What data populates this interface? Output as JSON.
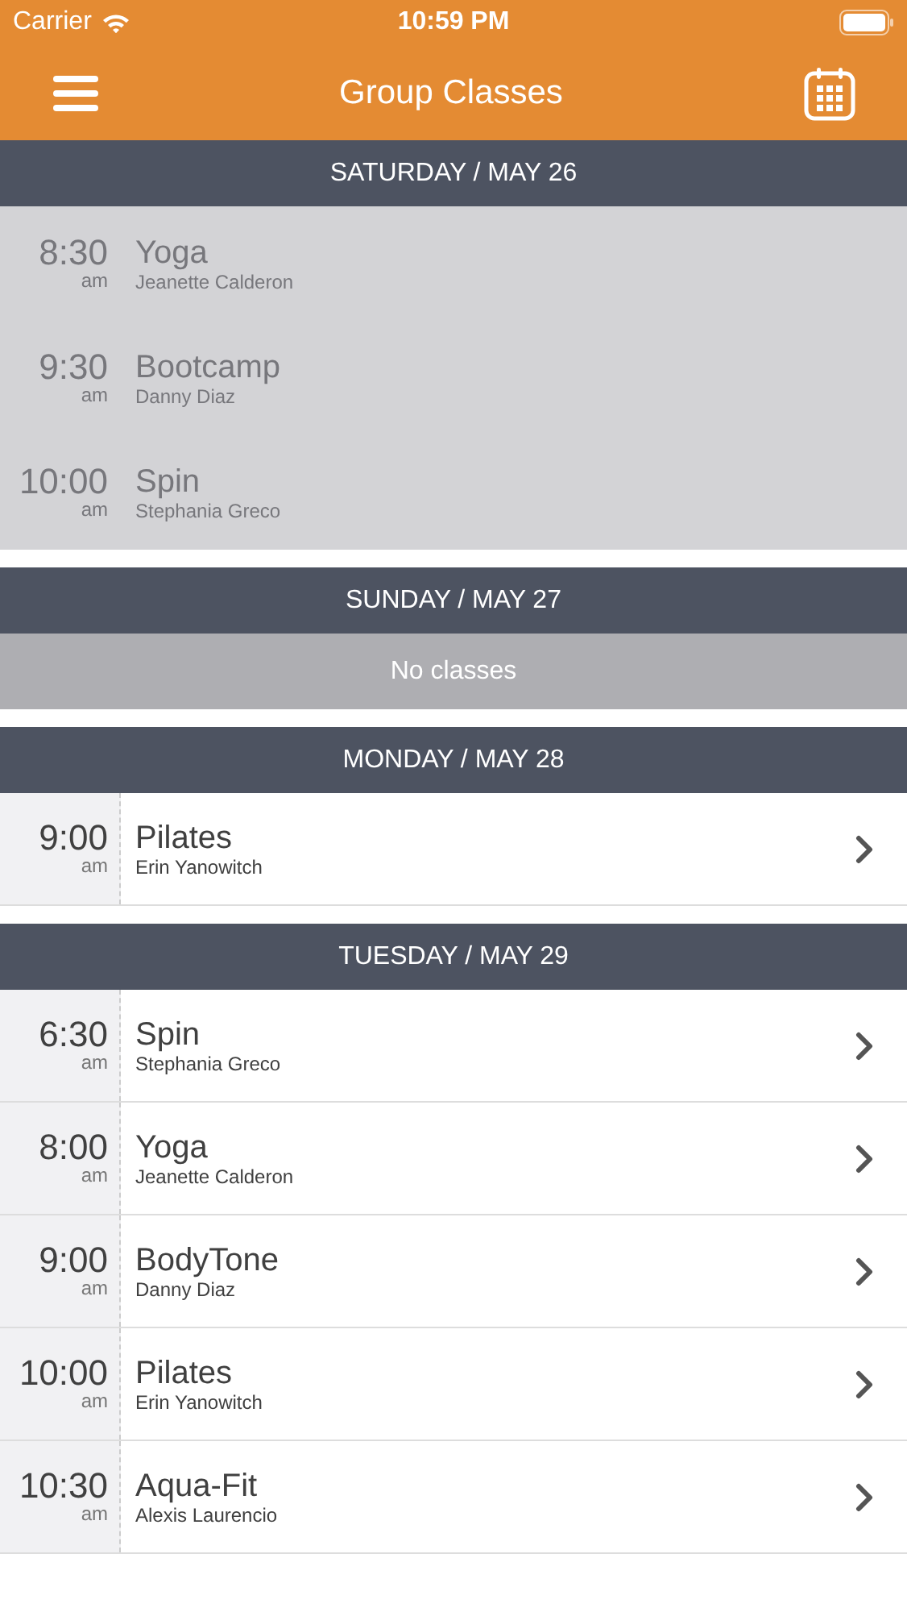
{
  "status_bar": {
    "carrier": "Carrier",
    "time": "10:59 PM"
  },
  "nav_bar": {
    "title": "Group Classes"
  },
  "days": [
    {
      "heading": "SATURDAY / MAY 26",
      "classes": [
        {
          "time": "8:30",
          "period": "am",
          "name": "Yoga",
          "instructor": "Jeanette Calderon",
          "past": true
        },
        {
          "time": "9:30",
          "period": "am",
          "name": "Bootcamp",
          "instructor": "Danny Diaz",
          "past": true
        },
        {
          "time": "10:00",
          "period": "am",
          "name": "Spin",
          "instructor": "Stephania Greco",
          "past": true
        }
      ]
    },
    {
      "heading": "SUNDAY / MAY 27",
      "empty_text": "No classes"
    },
    {
      "heading": "MONDAY / MAY 28",
      "classes": [
        {
          "time": "9:00",
          "period": "am",
          "name": "Pilates",
          "instructor": "Erin Yanowitch",
          "past": false
        }
      ]
    },
    {
      "heading": "TUESDAY / MAY 29",
      "classes": [
        {
          "time": "6:30",
          "period": "am",
          "name": "Spin",
          "instructor": "Stephania Greco",
          "past": false
        },
        {
          "time": "8:00",
          "period": "am",
          "name": "Yoga",
          "instructor": "Jeanette Calderon",
          "past": false
        },
        {
          "time": "9:00",
          "period": "am",
          "name": "BodyTone",
          "instructor": "Danny Diaz",
          "past": false
        },
        {
          "time": "10:00",
          "period": "am",
          "name": "Pilates",
          "instructor": "Erin Yanowitch",
          "past": false
        },
        {
          "time": "10:30",
          "period": "am",
          "name": "Aqua-Fit",
          "instructor": "Alexis Laurencio",
          "past": false
        }
      ]
    }
  ]
}
